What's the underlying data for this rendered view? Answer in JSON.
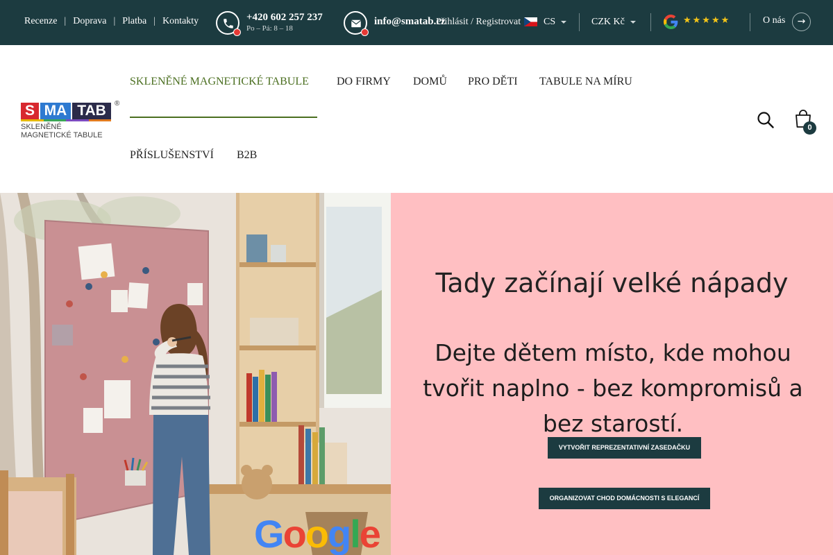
{
  "topbar": {
    "links": [
      "Recenze",
      "Doprava",
      "Platba",
      "Kontakty"
    ],
    "separator": "|",
    "phone": "+420 602 257 237",
    "hours": "Po – Pá: 8 – 18",
    "email": "info@smatab.cz",
    "login": "Přihlásit / Registrovat",
    "language": "CS",
    "currency": "CZK Kč",
    "rating_stars": "★★★★★",
    "about": "O nás",
    "about_arrow": "→"
  },
  "logo": {
    "letters": [
      "S",
      "MA",
      "TAB"
    ],
    "sub_line1": "SKLENĚNÉ",
    "sub_line2": "MAGNETICKÉ TABULE",
    "reg": "®"
  },
  "nav": {
    "items": [
      "SKLENĚNÉ MAGNETICKÉ TABULE",
      "DO FIRMY",
      "DOMŮ",
      "PRO DĚTI",
      "TABULE NA MÍRU",
      "PŘÍSLUŠENSTVÍ",
      "B2B"
    ],
    "active": "SKLENĚNÉ MAGNETICKÉ TABULE"
  },
  "cart": {
    "count": "0"
  },
  "hero": {
    "title": "Tady začínají velké nápady",
    "subtitle_line1": "Dejte dětem místo, kde mohou",
    "subtitle_line2": "tvořit naplno - bez kompromisů a",
    "subtitle_line3": "bez starostí.",
    "cta1": "VYTVOŘIT REPREZENTATIVNÍ ZASEDAČKU",
    "cta2": "ORGANIZOVAT CHOD DOMÁCNOSTI S ELEGANCÍ",
    "google_badge": "Google"
  },
  "colors": {
    "topbar_bg": "#1c3b40",
    "accent_green": "#4a6e1f",
    "hero_pink": "#ffbfc2",
    "notification_red": "#e53935",
    "star_yellow": "#f5c518"
  },
  "icons": [
    "phone-icon",
    "mail-icon",
    "czech-flag-icon",
    "google-icon",
    "search-icon",
    "cart-icon",
    "arrow-right-icon"
  ]
}
